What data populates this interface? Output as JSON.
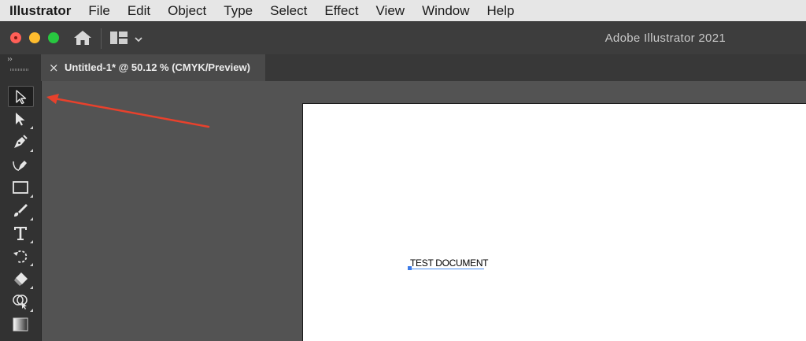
{
  "menubar": {
    "app": "Illustrator",
    "items": [
      "File",
      "Edit",
      "Object",
      "Type",
      "Select",
      "Effect",
      "View",
      "Window",
      "Help"
    ]
  },
  "titlebar": {
    "title": "Adobe Illustrator 2021"
  },
  "tab": {
    "close": "×",
    "title": "Untitled-1* @ 50.12 % (CMYK/Preview)"
  },
  "toolbar": {
    "collapse": "››",
    "tools": [
      {
        "name": "selection-tool-icon",
        "active": true
      },
      {
        "name": "direct-selection-tool-icon",
        "active": false
      },
      {
        "name": "pen-tool-icon",
        "active": false
      },
      {
        "name": "curvature-tool-icon",
        "active": false
      },
      {
        "name": "rectangle-tool-icon",
        "active": false
      },
      {
        "name": "paintbrush-tool-icon",
        "active": false
      },
      {
        "name": "type-tool-icon",
        "active": false
      },
      {
        "name": "rotate-tool-icon",
        "active": false
      },
      {
        "name": "eraser-tool-icon",
        "active": false
      },
      {
        "name": "shape-builder-tool-icon",
        "active": false
      },
      {
        "name": "gradient-tool-icon",
        "active": false
      }
    ]
  },
  "artboard": {
    "text": "TEST DOCUMENT"
  },
  "colors": {
    "accent_arrow": "#e8412c",
    "selection_blue": "#3d7be8"
  }
}
